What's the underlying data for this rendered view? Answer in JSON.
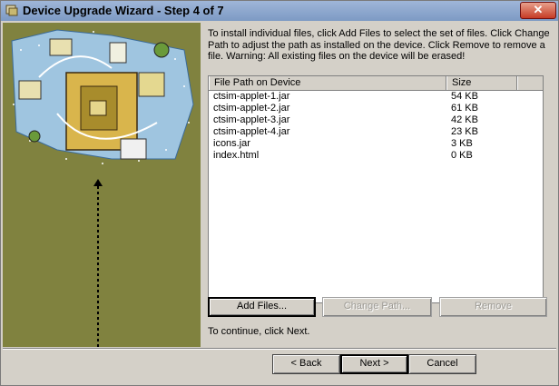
{
  "window": {
    "title": "Device Upgrade Wizard - Step 4 of 7",
    "close_label": "✕"
  },
  "instructions": "To install individual files, click Add Files to select the set of files.  Click Change Path to adjust the path as installed on the device.  Click Remove to remove a file.  Warning: All existing files on the device will be erased!",
  "file_list": {
    "columns": [
      "File Path on Device",
      "Size"
    ],
    "rows": [
      {
        "path": "ctsim-applet-1.jar",
        "size": "54 KB"
      },
      {
        "path": "ctsim-applet-2.jar",
        "size": "61 KB"
      },
      {
        "path": "ctsim-applet-3.jar",
        "size": "42 KB"
      },
      {
        "path": "ctsim-applet-4.jar",
        "size": "23 KB"
      },
      {
        "path": "icons.jar",
        "size": "3 KB"
      },
      {
        "path": "index.html",
        "size": "0 KB"
      }
    ]
  },
  "buttons": {
    "add_files": "Add Files...",
    "change_path": "Change Path...",
    "remove": "Remove",
    "back": "< Back",
    "next": "Next >",
    "cancel": "Cancel"
  },
  "continue_text": "To continue, click Next.",
  "colors": {
    "left_panel": "#80823f",
    "dialog_bg": "#d4d0c8"
  },
  "icons": [
    "app-icon",
    "close-icon",
    "wizard-illustration",
    "dashed-arrow-icon"
  ]
}
